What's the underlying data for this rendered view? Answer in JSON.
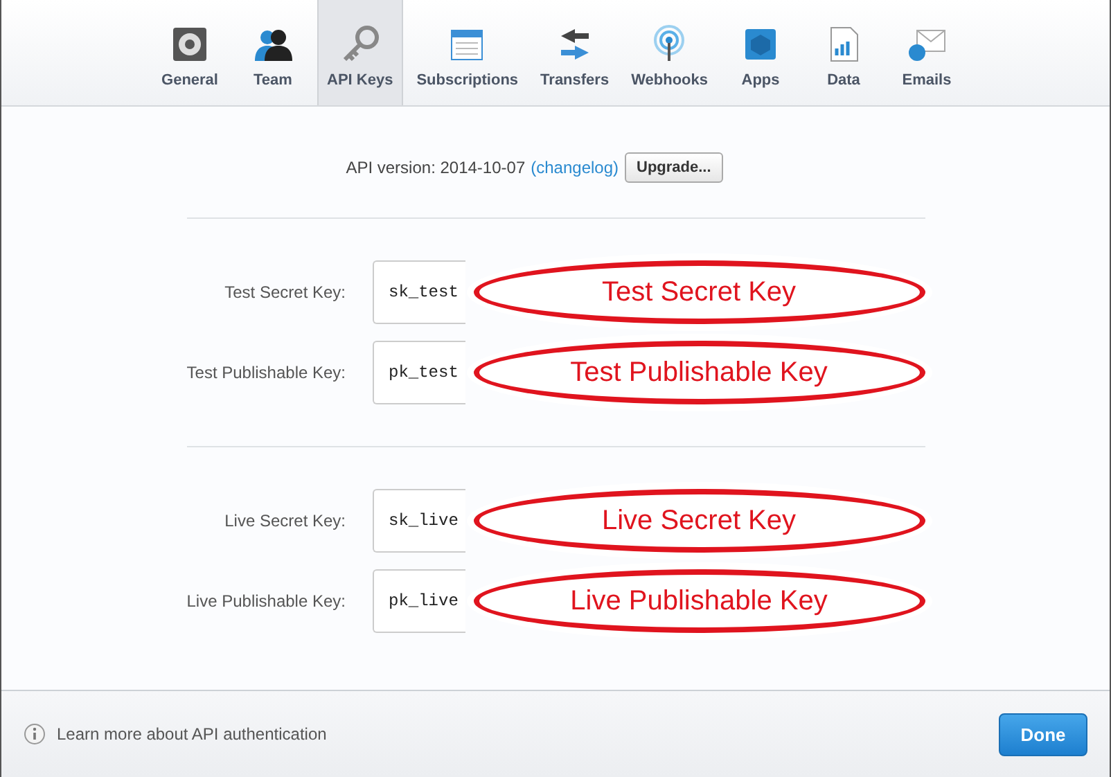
{
  "tabs": [
    {
      "label": "General",
      "selected": false
    },
    {
      "label": "Team",
      "selected": false
    },
    {
      "label": "API Keys",
      "selected": true
    },
    {
      "label": "Subscriptions",
      "selected": false
    },
    {
      "label": "Transfers",
      "selected": false
    },
    {
      "label": "Webhooks",
      "selected": false
    },
    {
      "label": "Apps",
      "selected": false
    },
    {
      "label": "Data",
      "selected": false
    },
    {
      "label": "Emails",
      "selected": false
    }
  ],
  "api_version": {
    "text": "API version: 2014-10-07",
    "link": "(changelog)",
    "button": "Upgrade..."
  },
  "sections": [
    {
      "rows": [
        {
          "label": "Test Secret Key:",
          "value": "sk_test",
          "annotation": "Test Secret Key"
        },
        {
          "label": "Test Publishable Key:",
          "value": "pk_test",
          "annotation": "Test Publishable Key"
        }
      ]
    },
    {
      "rows": [
        {
          "label": "Live Secret Key:",
          "value": "sk_live",
          "annotation": "Live Secret Key"
        },
        {
          "label": "Live Publishable Key:",
          "value": "pk_live",
          "annotation": "Live Publishable Key"
        }
      ]
    }
  ],
  "footer": {
    "link": "Learn more about API authentication",
    "button": "Done"
  }
}
